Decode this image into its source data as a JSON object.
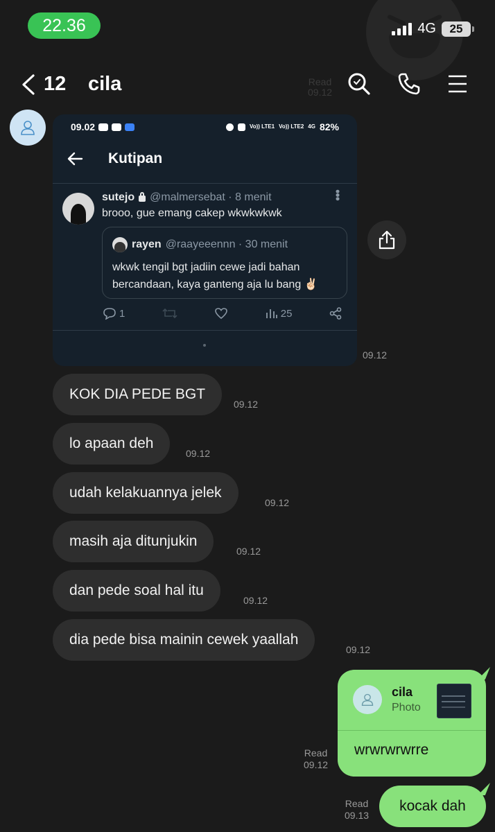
{
  "status_bar": {
    "time": "22.36",
    "network": "4G",
    "battery": "25"
  },
  "header": {
    "unread_count": "12",
    "title": "cila",
    "ghost_read": "Read",
    "ghost_time": "09.12"
  },
  "tweet_screenshot": {
    "status_time": "09.02",
    "status_battery": "82%",
    "status_lte1": "Vo)) LTE1",
    "status_lte2": "Vo)) LTE2",
    "status_4g": "4G",
    "page_title": "Kutipan",
    "author": "sutejo",
    "handle": "@malmersebat · 8 menit",
    "text": "brooo, gue emang cakep wkwkwkwk",
    "quote_author": "rayen",
    "quote_handle": "@raayeeennn · 30 menit",
    "quote_text": "wkwk tengil bgt jadiin cewe jadi bahan bercandaan, kaya ganteng aja lu bang ✌🏻",
    "replies": "1",
    "views": "25",
    "time": "09.12"
  },
  "messages_in": [
    {
      "text": "KOK DIA PEDE BGT",
      "time": "09.12"
    },
    {
      "text": "lo apaan deh",
      "time": "09.12"
    },
    {
      "text": "udah kelakuannya jelek",
      "time": "09.12"
    },
    {
      "text": "masih aja ditunjukin",
      "time": "09.12"
    },
    {
      "text": "dan pede soal hal itu",
      "time": "09.12"
    },
    {
      "text": "dia pede bisa mainin cewek yaallah",
      "time": "09.12"
    }
  ],
  "messages_out": [
    {
      "reply_name": "cila",
      "reply_type": "Photo",
      "text": "wrwrwrwrre",
      "status": "Read",
      "time": "09.12"
    },
    {
      "text": "kocak dah",
      "status": "Read",
      "time": "09.13"
    }
  ],
  "colors": {
    "background": "#1b1b1b",
    "incoming_bubble": "#2e2e2e",
    "outgoing_bubble": "#88e17b",
    "time_pill": "#39c355",
    "tweet_bg": "#15202b"
  },
  "icons": [
    "back-icon",
    "search-icon",
    "phone-icon",
    "menu-icon",
    "share-icon",
    "reply-icon",
    "retweet-icon",
    "like-icon",
    "views-icon",
    "share-tweet-icon",
    "person-icon"
  ]
}
